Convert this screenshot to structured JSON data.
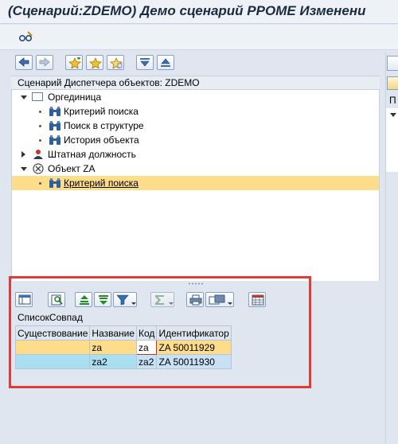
{
  "window": {
    "title": "(Сценарий:ZDEMO) Демо сценарий PPOME Изменени"
  },
  "tree": {
    "header": "Сценарий Диспетчера объектов: ZDEMO",
    "nodes": [
      {
        "label": "Оргединица"
      },
      {
        "label": "Критерий поиска"
      },
      {
        "label": "Поиск в структуре"
      },
      {
        "label": "История объекта"
      },
      {
        "label": "Штатная должность"
      },
      {
        "label": "Объект ZA"
      },
      {
        "label": "Критерий поиска"
      }
    ]
  },
  "result_list": {
    "title": "СписокСовпад",
    "columns": [
      "Существование",
      "Название",
      "Код",
      "Идентификатор"
    ],
    "rows": [
      {
        "existence": "",
        "name": "za",
        "code": "za",
        "id": "ZA 50011929"
      },
      {
        "existence": "",
        "name": "za2",
        "code": "za2",
        "id": "ZA 50011930"
      }
    ]
  },
  "right_pane": {
    "label": "П"
  },
  "colors": {
    "selection": "#fddd8a",
    "highlight_box": "#e03b35",
    "row_alt": "#a9dff0"
  }
}
